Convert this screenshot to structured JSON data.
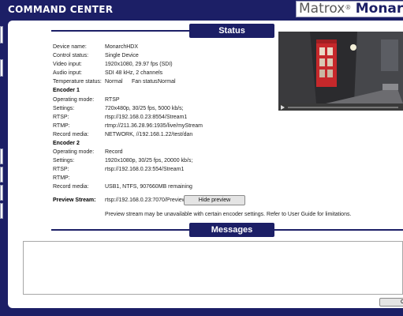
{
  "app": {
    "title": "COMMAND CENTER",
    "brand_matrox": "Matrox",
    "brand_reg": "®",
    "brand_monarch": "Monarch"
  },
  "status": {
    "section_title": "Status",
    "device_name": {
      "label": "Device name:",
      "value": "MonarchHDX"
    },
    "control_status": {
      "label": "Control status:",
      "value": "Single Device"
    },
    "video_input": {
      "label": "Video input:",
      "value": "1920x1080, 29.97 fps (SDI)"
    },
    "audio_input": {
      "label": "Audio input:",
      "value": "SDI 48 kHz, 2 channels"
    },
    "temperature": {
      "label": "Temperature status:",
      "value": "Normal",
      "fan_label": "Fan status:",
      "fan_value": "Normal"
    },
    "encoder1": {
      "heading": "Encoder 1",
      "operating_mode": {
        "label": "Operating mode:",
        "value": "RTSP"
      },
      "settings": {
        "label": "Settings:",
        "value": "720x480p, 30/25 fps, 5000 kb/s;"
      },
      "rtsp": {
        "label": "RTSP:",
        "value": "rtsp://192.168.0.23:8554/Stream1"
      },
      "rtmp": {
        "label": "RTMP:",
        "value": "rtmp://211.36.28.96:1935/live/myStream"
      },
      "record_media": {
        "label": "Record media:",
        "value": "NETWORK, //192.168.1.22/test/dan"
      }
    },
    "encoder2": {
      "heading": "Encoder 2",
      "operating_mode": {
        "label": "Operating mode:",
        "value": "Record"
      },
      "settings": {
        "label": "Settings:",
        "value": "1920x1080p, 30/25 fps, 20000 kb/s;"
      },
      "rtsp": {
        "label": "RTSP:",
        "value": "rtsp://192.168.0.23:554/Stream1"
      },
      "rtmp": {
        "label": "RTMP:",
        "value": ""
      },
      "record_media": {
        "label": "Record media:",
        "value": "USB1, NTFS, 907660MB remaining"
      }
    },
    "preview": {
      "label": "Preview Stream:",
      "value": "rtsp://192.168.0.23:7070/Preview",
      "button_label": "Hide preview",
      "note": "Preview stream may be unavailable with certain encoder settings. Refer to User Guide for limitations."
    }
  },
  "messages": {
    "section_title": "Messages",
    "button_label": "C"
  },
  "colors": {
    "navy": "#1c1f66",
    "panel": "#ffffff",
    "button": "#e4e4e4"
  }
}
